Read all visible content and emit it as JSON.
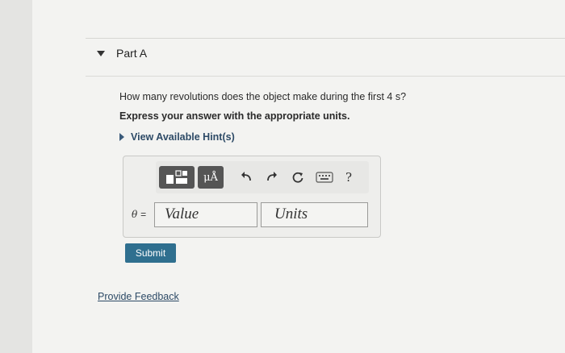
{
  "part": {
    "title": "Part A"
  },
  "question": {
    "text": "How many revolutions does the object make during the first 4 s?",
    "instruction": "Express your answer with the appropriate units."
  },
  "hint": {
    "label": "View Available Hint(s)"
  },
  "toolbar": {
    "units_label": "μÅ",
    "help_label": "?",
    "icons": [
      "templates-icon",
      "units-icon",
      "undo-icon",
      "redo-icon",
      "reset-icon",
      "keyboard-icon",
      "help-icon"
    ]
  },
  "answer": {
    "variable": "θ",
    "equals": "=",
    "value_placeholder": "Value",
    "units_placeholder": "Units"
  },
  "actions": {
    "submit_label": "Submit",
    "feedback_label": "Provide Feedback"
  },
  "colors": {
    "submit_bg": "#2f6f8f",
    "link": "#2d4a66",
    "toolbar_dark": "#555555"
  }
}
